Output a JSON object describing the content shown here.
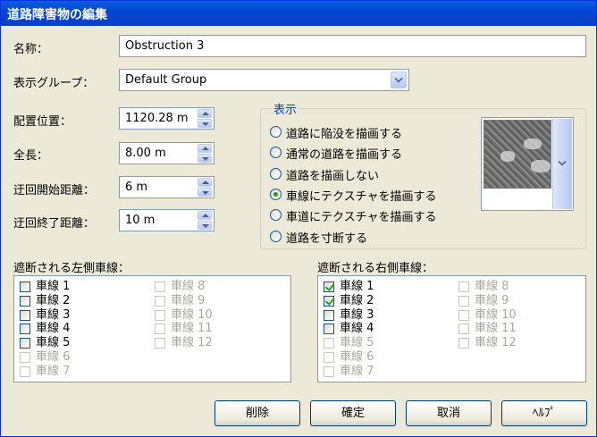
{
  "window": {
    "title": "道路障害物の編集"
  },
  "form": {
    "name_label": "名称：",
    "name_value": "Obstruction 3",
    "group_label": "表示グループ：",
    "group_value": "Default Group",
    "position_label": "配置位置：",
    "position_value": "1120.28 m",
    "length_label": "全長：",
    "length_value": "8.00 m",
    "detour_start_label": "迂回開始距離：",
    "detour_start_value": "6 m",
    "detour_end_label": "迂回終了距離：",
    "detour_end_value": "10 m"
  },
  "display": {
    "title": "表示",
    "options": [
      {
        "label": "道路に陥没を描画する",
        "selected": false
      },
      {
        "label": "通常の道路を描画する",
        "selected": false
      },
      {
        "label": "道路を描画しない",
        "selected": false
      },
      {
        "label": "車線にテクスチャを描画する",
        "selected": true
      },
      {
        "label": "車道にテクスチャを描画する",
        "selected": false
      },
      {
        "label": "道路を寸断する",
        "selected": false
      }
    ]
  },
  "left_lanes": {
    "label": "遮断される左側車線：",
    "items": [
      {
        "label": "車線 1",
        "checked": false,
        "enabled": true
      },
      {
        "label": "車線 2",
        "checked": false,
        "enabled": true
      },
      {
        "label": "車線 3",
        "checked": false,
        "enabled": true
      },
      {
        "label": "車線 4",
        "checked": false,
        "enabled": true
      },
      {
        "label": "車線 5",
        "checked": false,
        "enabled": true
      },
      {
        "label": "車線 6",
        "checked": false,
        "enabled": false
      },
      {
        "label": "車線 7",
        "checked": false,
        "enabled": false
      },
      {
        "label": "車線 8",
        "checked": false,
        "enabled": false
      },
      {
        "label": "車線 9",
        "checked": false,
        "enabled": false
      },
      {
        "label": "車線 10",
        "checked": false,
        "enabled": false
      },
      {
        "label": "車線 11",
        "checked": false,
        "enabled": false
      },
      {
        "label": "車線 12",
        "checked": false,
        "enabled": false
      }
    ]
  },
  "right_lanes": {
    "label": "遮断される右側車線：",
    "items": [
      {
        "label": "車線 1",
        "checked": true,
        "enabled": true
      },
      {
        "label": "車線 2",
        "checked": true,
        "enabled": true
      },
      {
        "label": "車線 3",
        "checked": false,
        "enabled": true
      },
      {
        "label": "車線 4",
        "checked": false,
        "enabled": true
      },
      {
        "label": "車線 5",
        "checked": false,
        "enabled": false
      },
      {
        "label": "車線 6",
        "checked": false,
        "enabled": false
      },
      {
        "label": "車線 7",
        "checked": false,
        "enabled": false
      },
      {
        "label": "車線 8",
        "checked": false,
        "enabled": false
      },
      {
        "label": "車線 9",
        "checked": false,
        "enabled": false
      },
      {
        "label": "車線 10",
        "checked": false,
        "enabled": false
      },
      {
        "label": "車線 11",
        "checked": false,
        "enabled": false
      },
      {
        "label": "車線 12",
        "checked": false,
        "enabled": false
      }
    ]
  },
  "buttons": {
    "delete": "削除",
    "ok": "確定",
    "cancel": "取消",
    "help": "ﾍﾙﾌﾟ"
  },
  "icons": {
    "group_dropdown": "chevron-down-icon",
    "texture_dropdown": "chevron-down-icon",
    "spinner": "spin-up-down-icon"
  },
  "colors": {
    "titlebar": "#0347d4",
    "window_bg": "#ece9d8",
    "group_title": "#0046d5",
    "check_mark": "#21a121"
  }
}
